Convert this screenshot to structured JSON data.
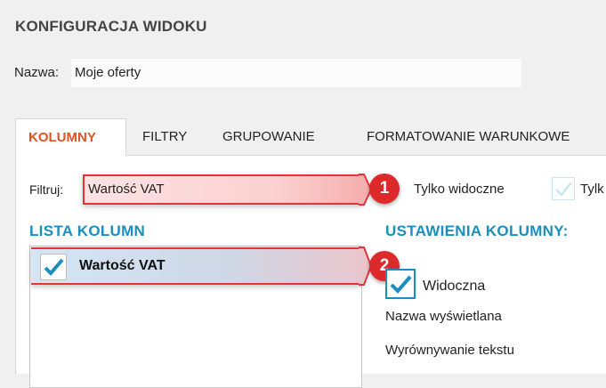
{
  "window": {
    "title": "KONFIGURACJA WIDOKU"
  },
  "name": {
    "label": "Nazwa:",
    "value": "Moje oferty"
  },
  "tabs": [
    {
      "label": "KOLUMNY",
      "active": true
    },
    {
      "label": "FILTRY",
      "active": false
    },
    {
      "label": "GRUPOWANIE",
      "active": false
    },
    {
      "label": "FORMATOWANIE WARUNKOWE",
      "active": false
    }
  ],
  "filter": {
    "label": "Filtruj:",
    "value": "Wartość VAT"
  },
  "only_visible": {
    "label": "Tylko widoczne",
    "next_label": "Tylk"
  },
  "columns_list": {
    "heading": "LISTA KOLUMN",
    "items": [
      {
        "label": "Wartość VAT",
        "checked": true
      }
    ]
  },
  "column_settings": {
    "heading": "USTAWIENIA KOLUMNY:",
    "visible_label": "Widoczna",
    "visible_checked": true,
    "display_name_label": "Nazwa wyświetlana",
    "text_align_label": "Wyrównywanie tekstu"
  },
  "callouts": {
    "first": "1",
    "second": "2"
  },
  "colors": {
    "accent_orange": "#e0521f",
    "accent_blue": "#1a8fbf",
    "callout_red": "#dc2a2a"
  }
}
